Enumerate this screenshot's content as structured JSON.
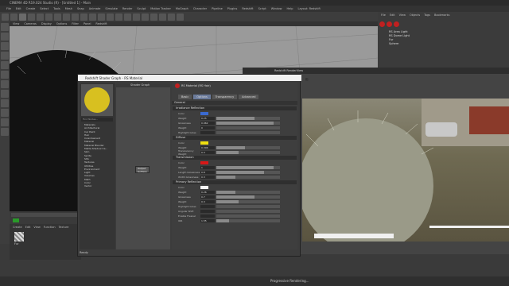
{
  "window": {
    "title": "CINEMA 4D R19.024 Studio (R) - [Untitled 1] - Main"
  },
  "menu": [
    "File",
    "Edit",
    "Create",
    "Select",
    "Tools",
    "Mesh",
    "Snap",
    "Animate",
    "Simulate",
    "Render",
    "Sculpt",
    "Motion Tracker",
    "MoGraph",
    "Character",
    "Pipeline",
    "Plugins",
    "Redshift",
    "Script",
    "Window",
    "Help",
    "Layout: Redshift"
  ],
  "viewport_menu": [
    "View",
    "Cameras",
    "Display",
    "Options",
    "Filter",
    "Panel",
    "Redshift"
  ],
  "object_manager": {
    "menu": [
      "File",
      "Edit",
      "View",
      "Objects",
      "Tags",
      "Bookmarks"
    ],
    "items": [
      "RS Area Light",
      "RS Dome Light",
      "Fur",
      "Sphere"
    ]
  },
  "render_view": {
    "title": "Redshift RenderView"
  },
  "shader_graph": {
    "title": "Redshift Shader Graph - RS Material",
    "preview_label": "Find Nodes...",
    "tree": [
      "Materials",
      "Architectural",
      "Car Paint",
      "Hair",
      "Incandescent",
      "Material",
      "Material Blender",
      "Matte-Shadow Ca...",
      "Skin",
      "Sprite",
      "SSS",
      "Textures",
      "Utilities",
      "Environment",
      "Light",
      "Volumes",
      "Math",
      "Color",
      "Vector"
    ],
    "graph_title": "Shader Graph",
    "nodes": [
      {
        "name": "Output",
        "port": "Surface"
      }
    ],
    "node_title": "RS Material (RS Hair)",
    "tabs": [
      "Basic",
      "Options",
      "Transparency",
      "Advanced"
    ],
    "active_tab": "Options",
    "header": "General",
    "sections": [
      {
        "title": "Irradiance Reflection",
        "props": [
          {
            "label": "Color",
            "value": "",
            "fill": 0,
            "color": "#3a6ad0"
          },
          {
            "label": "Weight",
            "value": "0.25",
            "fill": 0.6
          },
          {
            "label": "Glossiness",
            "value": "0.962",
            "fill": 0.9
          },
          {
            "label": "Weight",
            "value": "0",
            "fill": 0.0
          },
          {
            "label": "Highlight Gloss",
            "value": "",
            "fill": 0.0
          }
        ]
      },
      {
        "title": "Diffuse",
        "props": [
          {
            "label": "Color",
            "value": "",
            "fill": 0,
            "color": "#f0e010"
          },
          {
            "label": "Weight",
            "value": "0.306",
            "fill": 0.45
          },
          {
            "label": "Translucency Weight",
            "value": "0.3",
            "fill": 0.35
          }
        ]
      },
      {
        "title": "Transmission",
        "props": [
          {
            "label": "Color",
            "value": "",
            "fill": 0,
            "color": "#d81818"
          },
          {
            "label": "Weight",
            "value": "1",
            "fill": 0.9
          },
          {
            "label": "Length Glossiness",
            "value": "0.8",
            "fill": 0.75
          },
          {
            "label": "Width Glossiness",
            "value": "0.3",
            "fill": 0.3
          }
        ]
      },
      {
        "title": "Primary Reflection",
        "props": [
          {
            "label": "Color",
            "value": "",
            "fill": 0,
            "color": "#f4f4f4"
          },
          {
            "label": "Weight",
            "value": "0.26",
            "fill": 0.3
          },
          {
            "label": "Glossiness",
            "value": "0.7",
            "fill": 0.6
          },
          {
            "label": "Weight",
            "value": "0.3",
            "fill": 0.35
          },
          {
            "label": "Highlight Gloss",
            "value": "",
            "fill": 0.0
          },
          {
            "label": "Angular Shift",
            "value": "",
            "fill": 0.0
          },
          {
            "label": "Enable Fresnel",
            "value": "",
            "fill": 0.0
          },
          {
            "label": "IOR",
            "value": "1.55",
            "fill": 0.2
          }
        ]
      }
    ]
  },
  "material_manager": {
    "tabs": [
      "Create",
      "Edit",
      "View",
      "Function",
      "Texture"
    ],
    "material": "Fur"
  },
  "status": {
    "text": "Progressive Rendering..."
  },
  "bottom_label": "Ready"
}
